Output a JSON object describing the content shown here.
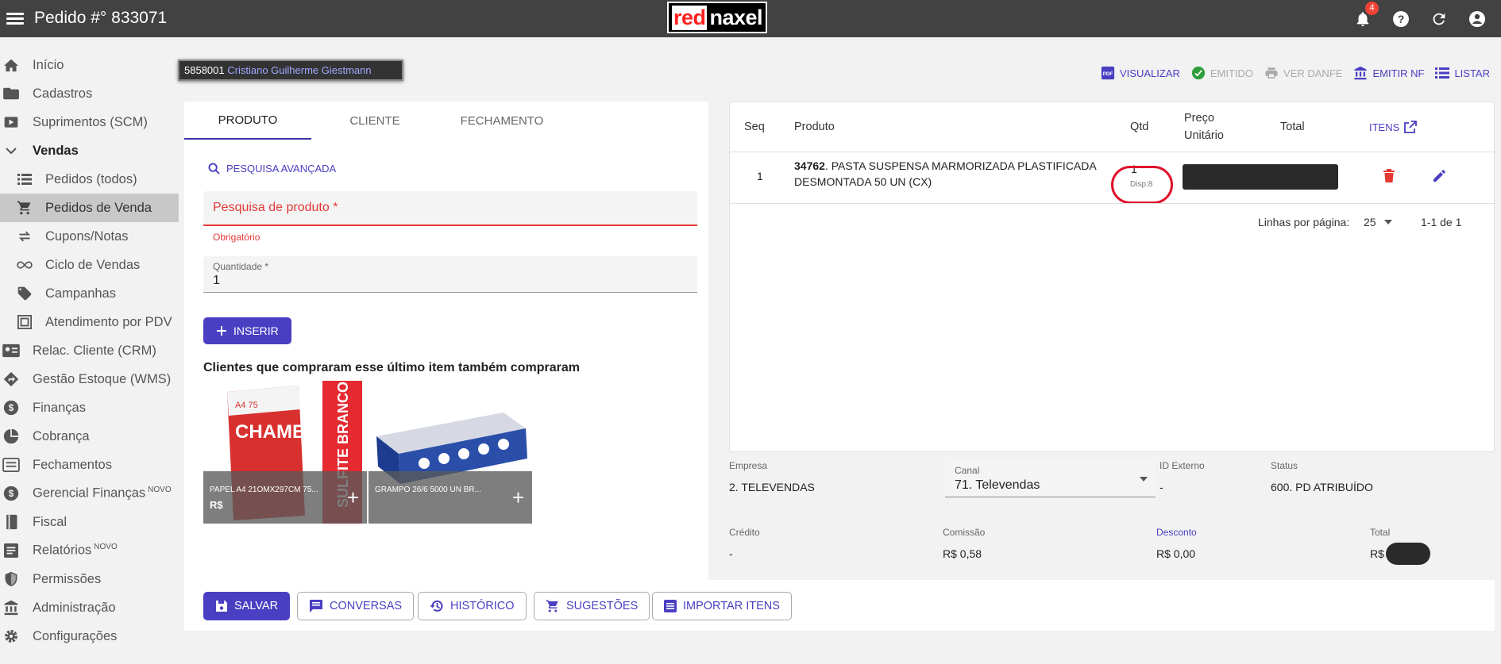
{
  "header": {
    "title": "Pedido #° 833071",
    "logo_red": "red",
    "logo_white": "naxel",
    "notifications_count": "4"
  },
  "sidebar": {
    "items": [
      {
        "label": "Início",
        "icon": "home-icon"
      },
      {
        "label": "Cadastros",
        "icon": "folder-icon"
      },
      {
        "label": "Suprimentos (SCM)",
        "icon": "supplies-icon"
      },
      {
        "label": "Vendas",
        "icon": "chevron-down-icon"
      },
      {
        "label": "Pedidos (todos)",
        "icon": "list-icon"
      },
      {
        "label": "Pedidos de Venda",
        "icon": "cart-icon"
      },
      {
        "label": "Cupons/Notas",
        "icon": "exchange-icon"
      },
      {
        "label": "Ciclo de Vendas",
        "icon": "infinity-icon"
      },
      {
        "label": "Campanhas",
        "icon": "tag-icon"
      },
      {
        "label": "Atendimento por PDV",
        "icon": "pdv-icon"
      },
      {
        "label": "Relac. Cliente (CRM)",
        "icon": "contact-card-icon"
      },
      {
        "label": "Gestão Estoque (WMS)",
        "icon": "directions-icon"
      },
      {
        "label": "Finanças",
        "icon": "dollar-icon"
      },
      {
        "label": "Cobrança",
        "icon": "pie-icon"
      },
      {
        "label": "Fechamentos",
        "icon": "register-icon"
      },
      {
        "label": "Gerencial Finanças",
        "icon": "dollar-icon",
        "badge": "NOVO"
      },
      {
        "label": "Fiscal",
        "icon": "book-icon"
      },
      {
        "label": "Relatórios",
        "icon": "report-icon",
        "badge": "NOVO"
      },
      {
        "label": "Permissões",
        "icon": "shield-icon"
      },
      {
        "label": "Administração",
        "icon": "bank-icon"
      },
      {
        "label": "Configurações",
        "icon": "gear-icon"
      }
    ]
  },
  "customer": {
    "number": "5858001",
    "name": "Cristiano Guilherme Giestmann"
  },
  "actions": {
    "visualizar": "VISUALIZAR",
    "emitido": "EMITIDO",
    "ver_danfe": "VER DANFE",
    "emitir_nf": "EMITIR NF",
    "listar": "LISTAR"
  },
  "tabs": [
    "PRODUTO",
    "CLIENTE",
    "FECHAMENTO"
  ],
  "form": {
    "advanced_search": "PESQUISA AVANÇADA",
    "product_placeholder": "Pesquisa de produto *",
    "required_msg": "Obrigatório",
    "qty_label": "Quantidade *",
    "qty_value": "1",
    "insert_label": "INSERIR"
  },
  "recommendations": {
    "title": "Clientes que compraram esse último item também compraram",
    "items": [
      {
        "name": "PAPEL A4 21OMX297CM 75...",
        "price": "R$"
      },
      {
        "name": "GRAMPO 26/6 5000 UN BR...",
        "price": ""
      }
    ]
  },
  "table": {
    "headers": {
      "seq": "Seq",
      "produto": "Produto",
      "qtd": "Qtd",
      "preco": "Preço Unitário",
      "total": "Total",
      "itens": "ITENS"
    },
    "rows": [
      {
        "seq": "1",
        "code": "34762",
        "description": ". PASTA SUSPENSA MARMORIZADA PLASTIFICADA DESMONTADA 50 UN (CX)",
        "qtd": "1",
        "disp": "Disp:8"
      }
    ],
    "rows_per_page_label": "Linhas por página:",
    "rows_per_page": "25",
    "range": "1-1 de 1"
  },
  "summary": {
    "empresa_label": "Empresa",
    "empresa": "2. TELEVENDAS",
    "canal_label": "Canal",
    "canal": "71. Televendas",
    "id_externo_label": "ID Externo",
    "id_externo": "-",
    "status_label": "Status",
    "status": "600. PD ATRIBUÍDO",
    "credito_label": "Crédito",
    "credito": "-",
    "comissao_label": "Comissão",
    "comissao": "R$ 0,58",
    "desconto_label": "Desconto",
    "desconto": "R$ 0,00",
    "total_label": "Total",
    "total": "R$ 1"
  },
  "bottom_buttons": {
    "salvar": "SALVAR",
    "conversas": "CONVERSAS",
    "historico": "HISTÓRICO",
    "sugestoes": "SUGESTÕES",
    "importar": "IMPORTAR ITENS"
  },
  "colors": {
    "accent": "#4a3fc2",
    "error": "#e53935",
    "topbar": "#424242"
  }
}
